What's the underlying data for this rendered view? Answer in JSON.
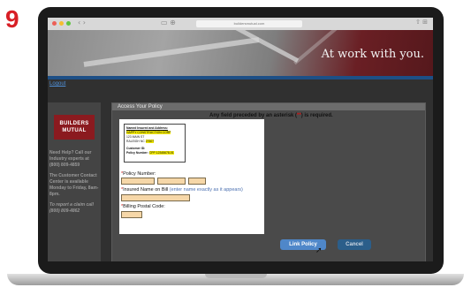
{
  "step_number": "9",
  "browser": {
    "url": "buildersmutual.com",
    "nav_arrows": "‹ ›",
    "tab_icons": "▭ ⊕",
    "right_icons": "⇧ ⊞",
    "dot_colors": [
      "#ec5f57",
      "#f5bd2f",
      "#5fc43f"
    ]
  },
  "hero": {
    "tagline": "At work with you."
  },
  "header": {
    "logout": "Logout"
  },
  "sidebar": {
    "logo_line1": "BUILDERS",
    "logo_line2": "MUTUAL",
    "help_text": "Need Help? Call our Industry experts at (800) 809-4859",
    "contact_text": "The Customer Contact Center is available Monday to Friday, 8am-8pm.",
    "claim_text": "To report a claim call (800) 809-4862"
  },
  "panel": {
    "title": "Access Your Policy",
    "required_note_prefix": "Any field preceded by an asterisk (",
    "required_note_star": "**",
    "required_note_suffix": ") is required."
  },
  "sample_doc": {
    "heading": "Named Insured and Address:",
    "company": "HAPPY CONSTRUCTION CORP",
    "street": "123 MAIN ST",
    "city": "RALEIGH NC",
    "zip": "27607",
    "customer_id_label": "Customer ID:",
    "policy_label": "Policy Number:",
    "policy_value": "CPP 12345678-01"
  },
  "form": {
    "star": "*",
    "policy_number_label": "Policy Number:",
    "insured_name_label": "Insured Name on Bill",
    "insured_name_hint": "(enter name exactly as it appears)",
    "postal_code_label": "Billing Postal Code:"
  },
  "buttons": {
    "link_policy": "Link Policy",
    "cancel": "Cancel"
  }
}
